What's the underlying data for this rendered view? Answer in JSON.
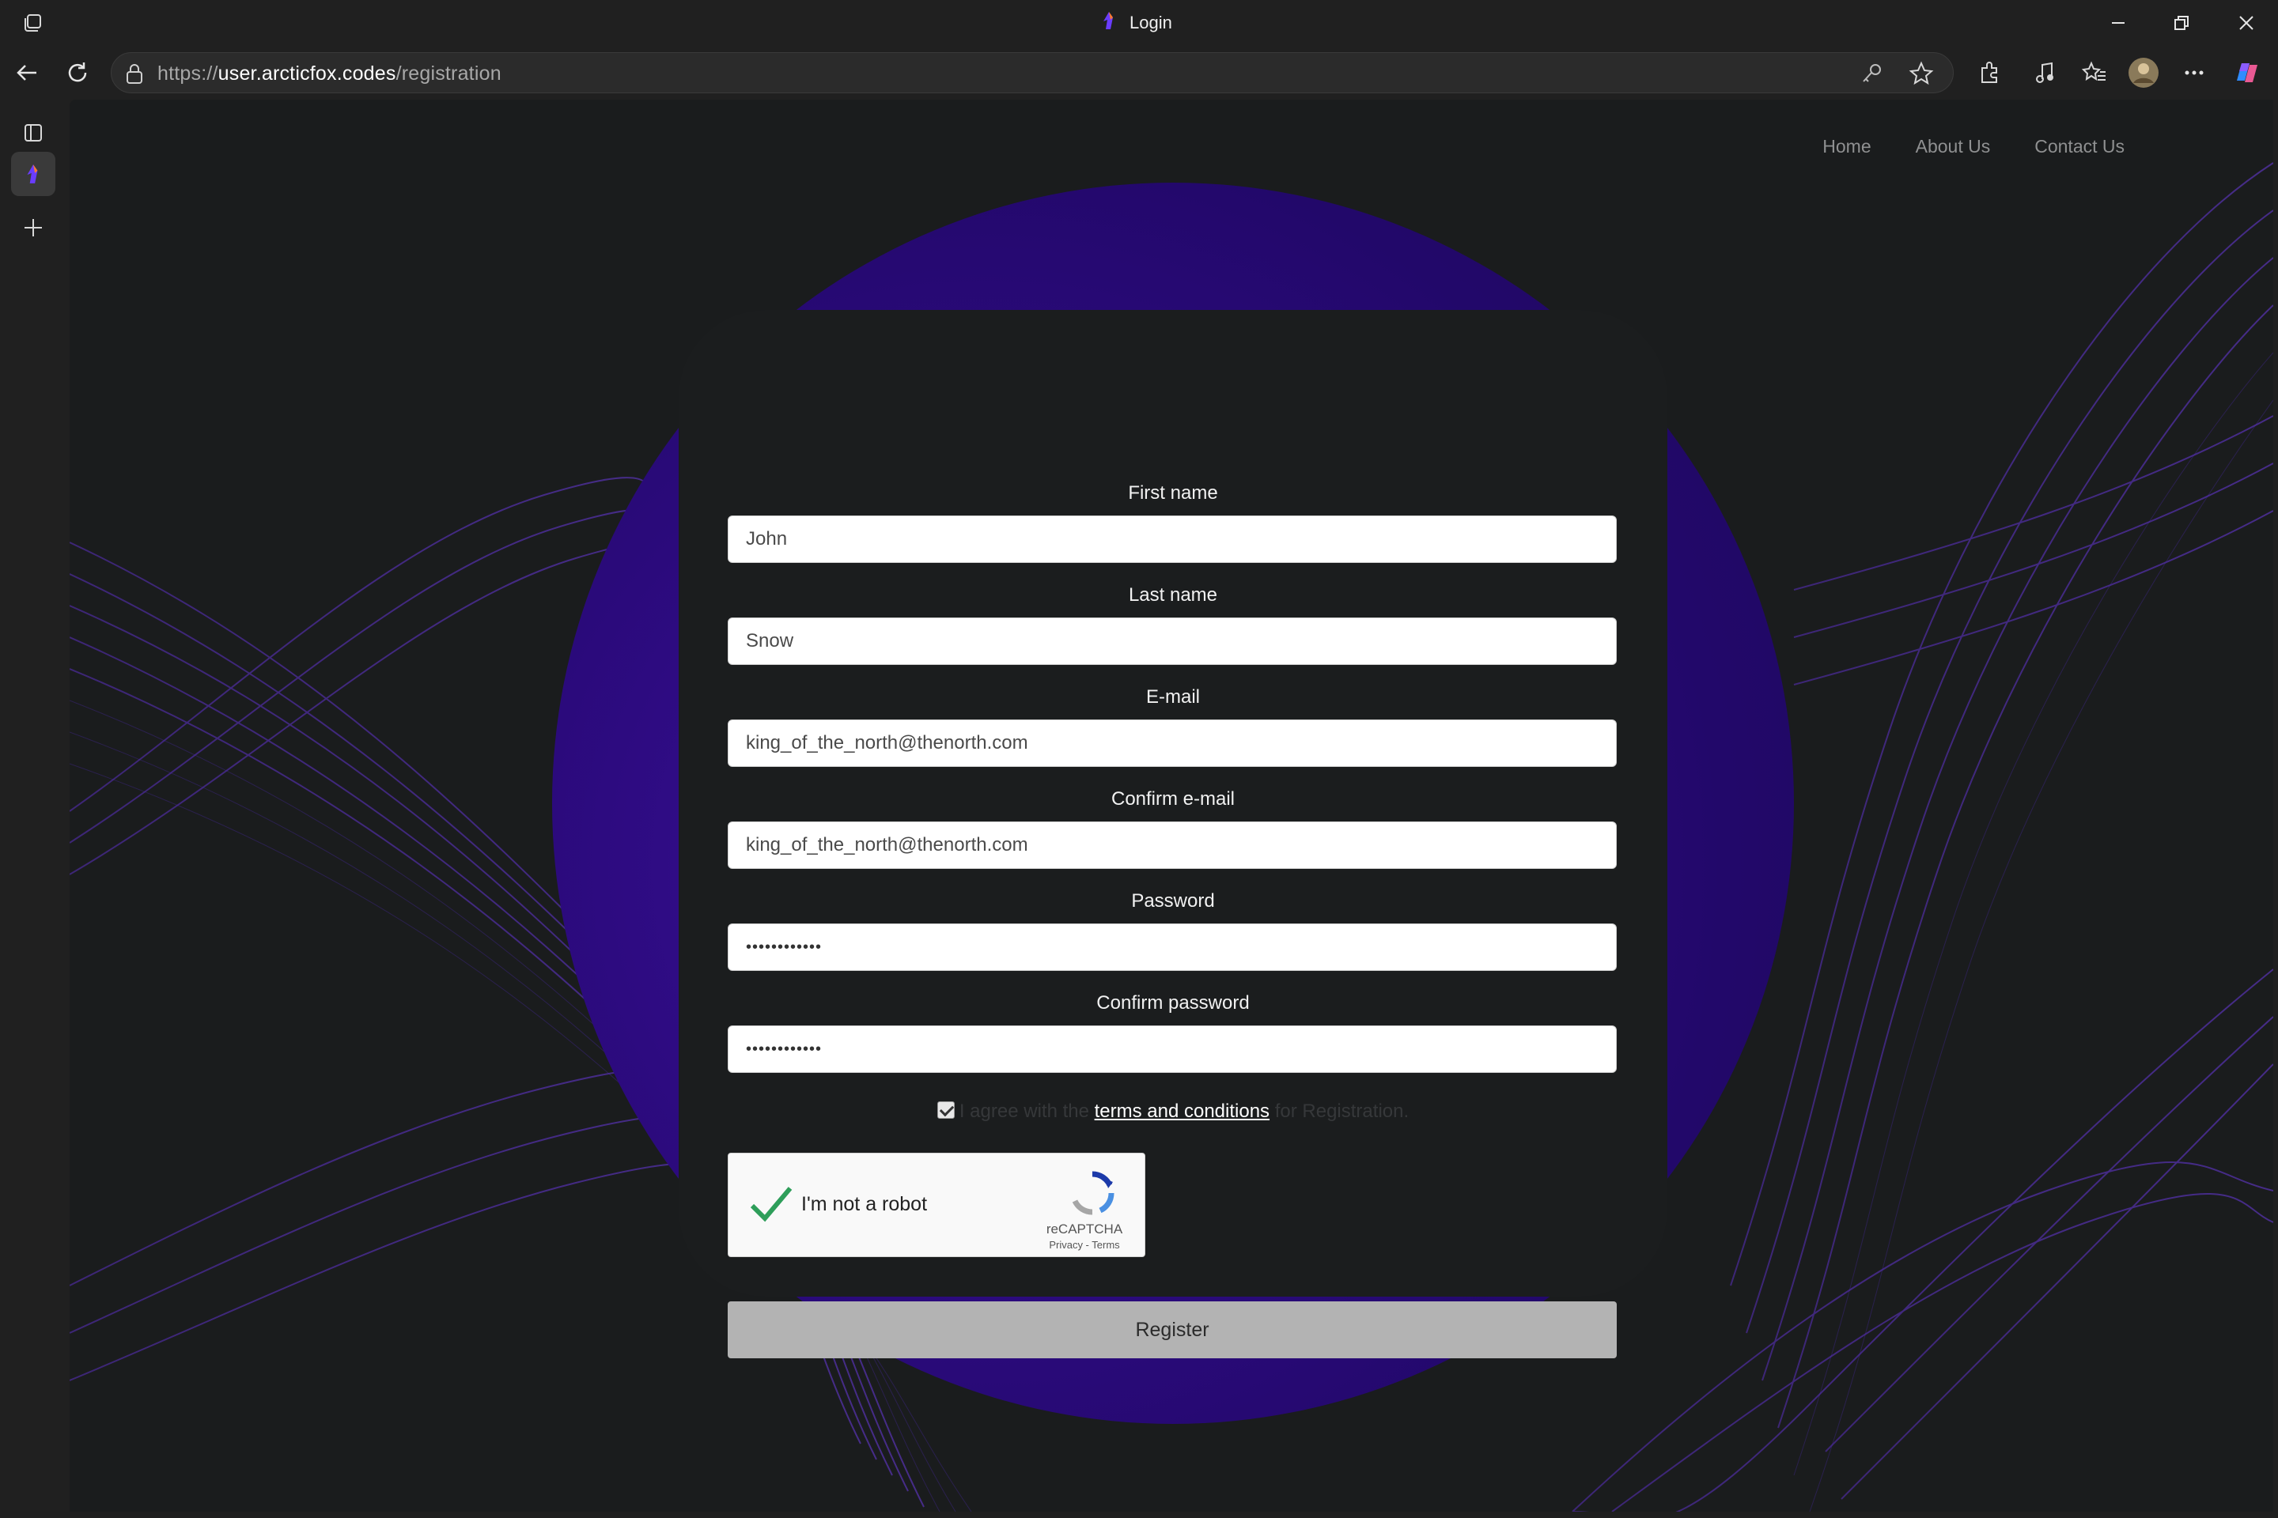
{
  "window": {
    "title": "Login"
  },
  "address_bar": {
    "protocol": "https://",
    "host": "user.arcticfox.codes",
    "path": "/registration"
  },
  "nav": {
    "links": [
      "Home",
      "About Us",
      "Contact Us"
    ]
  },
  "form": {
    "fields": [
      {
        "label": "First name",
        "value": "John"
      },
      {
        "label": "Last name",
        "value": "Snow"
      },
      {
        "label": "E-mail",
        "value": "king_of_the_north@thenorth.com"
      },
      {
        "label": "Confirm e-mail",
        "value": "king_of_the_north@thenorth.com"
      },
      {
        "label": "Password",
        "value": "••••••••••••"
      },
      {
        "label": "Confirm password",
        "value": "••••••••••••"
      }
    ],
    "agree": {
      "checked": true,
      "prefix": "I agree with the ",
      "link": "terms and conditions",
      "suffix": " for Registration."
    },
    "captcha": {
      "label": "I'm not a robot",
      "brand": "reCAPTCHA",
      "links": "Privacy - Terms",
      "checked": true
    },
    "submit_label": "Register"
  },
  "colors": {
    "accent_purple": "#2a0a7a",
    "card_bg": "#1b1d1e",
    "page_bg": "#1a1c1d",
    "button_bg": "#b3b3b3"
  }
}
